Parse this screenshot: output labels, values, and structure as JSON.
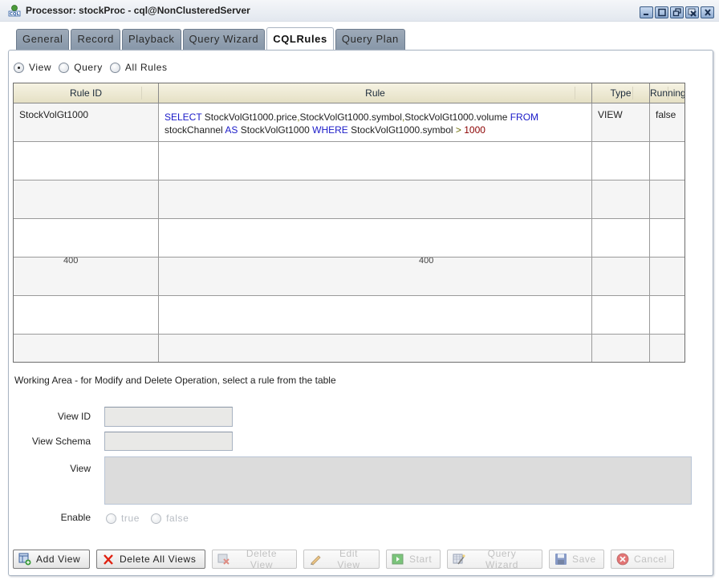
{
  "window": {
    "title": "Processor: stockProc - cql@NonClusteredServer",
    "app_icon": "cql-icon",
    "controls": [
      "minimize-icon",
      "maximize-icon",
      "restore-icon",
      "close-all-icon",
      "close-icon"
    ]
  },
  "tabs": [
    {
      "label": "General",
      "active": false
    },
    {
      "label": "Record",
      "active": false
    },
    {
      "label": "Playback",
      "active": false
    },
    {
      "label": "Query Wizard",
      "active": false
    },
    {
      "label": "CQLRules",
      "active": true
    },
    {
      "label": "Query Plan",
      "active": false
    }
  ],
  "filter": {
    "options": [
      {
        "label": "View",
        "checked": true
      },
      {
        "label": "Query",
        "checked": false
      },
      {
        "label": "All Rules",
        "checked": false
      }
    ]
  },
  "table": {
    "columns": [
      "Rule ID",
      "Rule",
      "Type",
      "Running"
    ],
    "rows": [
      {
        "rule_id": "StockVolGt1000",
        "rule_tokens": [
          {
            "t": "SELECT",
            "c": "kw"
          },
          {
            "t": " StockVolGt1000.price",
            "c": ""
          },
          {
            "t": ",",
            "c": "op"
          },
          {
            "t": "StockVolGt1000.symbol",
            "c": ""
          },
          {
            "t": ",",
            "c": "op"
          },
          {
            "t": "StockVolGt1000.volume ",
            "c": ""
          },
          {
            "t": "FROM",
            "c": "kw"
          },
          {
            "t": "\n",
            "c": "br"
          },
          {
            "t": "stockChannel ",
            "c": ""
          },
          {
            "t": "AS",
            "c": "kw"
          },
          {
            "t": " StockVolGt1000 ",
            "c": ""
          },
          {
            "t": "WHERE",
            "c": "kw"
          },
          {
            "t": " StockVolGt1000.symbol ",
            "c": ""
          },
          {
            "t": ">",
            "c": "op"
          },
          {
            "t": " 1000",
            "c": "num"
          }
        ],
        "type": "VIEW",
        "running": "false"
      }
    ],
    "empty_rows": 6,
    "artifact_text": "400"
  },
  "working_area": {
    "label": "Working Area - for Modify and Delete Operation, select a rule from the table",
    "view_id_label": "View ID",
    "view_id_value": "",
    "view_schema_label": "View Schema",
    "view_schema_value": "",
    "view_label": "View",
    "view_value": "",
    "enable_label": "Enable",
    "enable_options": [
      {
        "label": "true",
        "checked": false
      },
      {
        "label": "false",
        "checked": false
      }
    ]
  },
  "buttons": [
    {
      "label": "Add View",
      "icon": "add-view-icon",
      "enabled": true
    },
    {
      "label": "Delete All Views",
      "icon": "delete-all-icon",
      "enabled": true
    },
    {
      "label": "Delete View",
      "icon": "delete-view-icon",
      "enabled": false
    },
    {
      "label": "Edit View",
      "icon": "pencil-icon",
      "enabled": false
    },
    {
      "label": "Start",
      "icon": "play-icon",
      "enabled": false
    },
    {
      "label": "Query Wizard",
      "icon": "query-wizard-icon",
      "enabled": false
    },
    {
      "label": "Save",
      "icon": "save-icon",
      "enabled": false
    },
    {
      "label": "Cancel",
      "icon": "cancel-icon",
      "enabled": false
    }
  ]
}
